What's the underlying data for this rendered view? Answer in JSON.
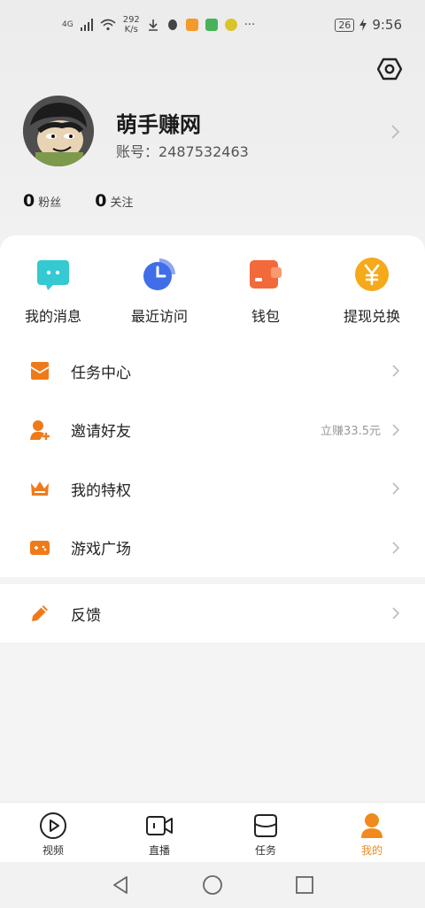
{
  "status_bar": {
    "network": "4G",
    "net_speed_value": "292",
    "net_speed_unit": "K/s",
    "battery": "26",
    "time": "9:56",
    "more": "···"
  },
  "profile": {
    "nickname": "萌手赚网",
    "account_label": "账号：",
    "account_number": "2487532463",
    "fans_count": "0",
    "fans_label": "粉丝",
    "following_count": "0",
    "following_label": "关注"
  },
  "quick_actions": [
    {
      "label": "我的消息",
      "icon": "message-icon",
      "color": "#35c9d1"
    },
    {
      "label": "最近访问",
      "icon": "clock-icon",
      "color": "#3f6ee8"
    },
    {
      "label": "钱包",
      "icon": "wallet-icon",
      "color": "#f2693a"
    },
    {
      "label": "提现兑换",
      "icon": "yuan-icon",
      "color": "#f5a91b"
    }
  ],
  "menu": [
    {
      "label": "任务中心",
      "icon": "task-envelope-icon",
      "extra": ""
    },
    {
      "label": "邀请好友",
      "icon": "invite-user-icon",
      "extra": "立赚33.5元"
    },
    {
      "label": "我的特权",
      "icon": "crown-icon",
      "extra": ""
    },
    {
      "label": "游戏广场",
      "icon": "gamepad-icon",
      "extra": ""
    }
  ],
  "feedback": {
    "label": "反馈",
    "icon": "pencil-icon"
  },
  "tabs": [
    {
      "label": "视频",
      "icon": "play-icon",
      "active": false
    },
    {
      "label": "直播",
      "icon": "live-camera-icon",
      "active": false
    },
    {
      "label": "任务",
      "icon": "task-cylinder-icon",
      "active": false
    },
    {
      "label": "我的",
      "icon": "person-icon",
      "active": true
    }
  ],
  "colors": {
    "accent": "#f08a1c",
    "menu_icon": "#f07a1a"
  }
}
